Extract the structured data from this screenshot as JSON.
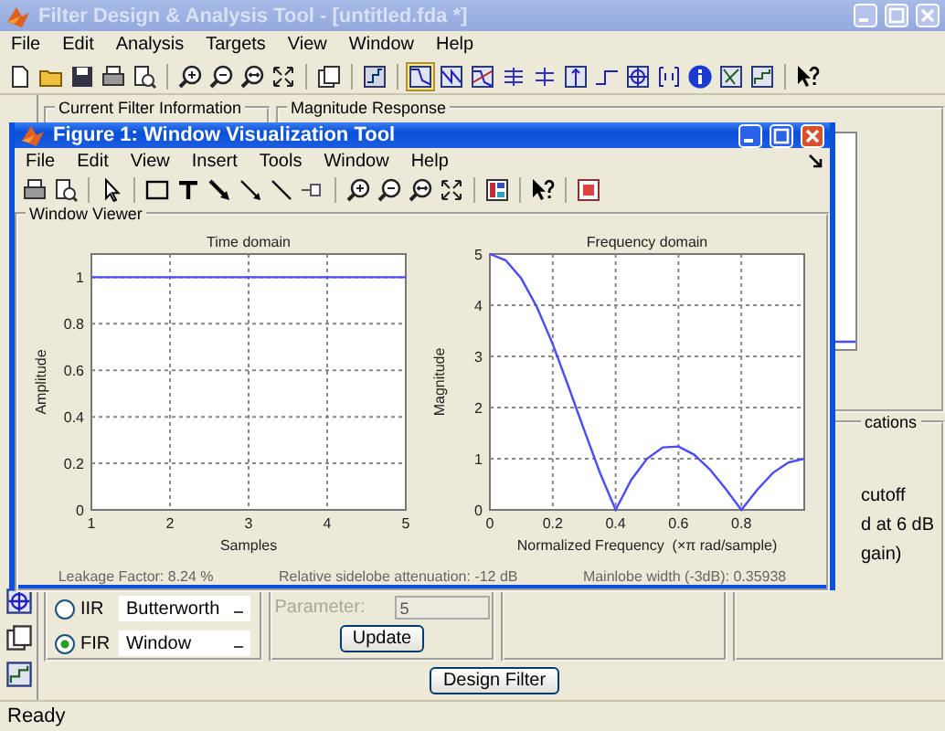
{
  "window": {
    "title": "Filter Design & Analysis Tool - [untitled.fda *]",
    "active": false
  },
  "menu": [
    "File",
    "Edit",
    "Analysis",
    "Targets",
    "View",
    "Window",
    "Help"
  ],
  "analysis_buttons": [
    {
      "kind": "magnitude",
      "selected": true
    },
    {
      "kind": "phase",
      "selected": false
    },
    {
      "kind": "magphase",
      "selected": false
    },
    {
      "kind": "groupdelay",
      "selected": false
    },
    {
      "kind": "phasedelay",
      "selected": false
    },
    {
      "kind": "impulse",
      "selected": false
    },
    {
      "kind": "step",
      "selected": false
    },
    {
      "kind": "polezero",
      "selected": false
    },
    {
      "kind": "coefficients",
      "selected": false
    },
    {
      "kind": "info",
      "selected": false
    },
    {
      "kind": "magest",
      "selected": false
    },
    {
      "kind": "noise",
      "selected": false
    }
  ],
  "current_filter_information": {
    "title": "Current Filter Information"
  },
  "magnitude_response": {
    "title": "Magnitude Response"
  },
  "response_panel": {
    "rows": [
      {
        "label": "IIR",
        "selected": false,
        "value": "Butterworth"
      },
      {
        "label": "FIR",
        "selected": true,
        "value": "Window"
      }
    ]
  },
  "options_panel": {
    "parameter": {
      "label": "Parameter:",
      "value": "5",
      "disabled": true
    },
    "update_button": "Update"
  },
  "specifications_panel": {
    "title": "cations",
    "lines": [
      "cutoff",
      "d at 6 dB",
      "gain)"
    ]
  },
  "design_button": "Design Filter",
  "status_bar": "Ready",
  "figure": {
    "title": "Figure 1: Window Visualization Tool",
    "active": true,
    "menu": [
      "File",
      "Edit",
      "View",
      "Insert",
      "Tools",
      "Window",
      "Help"
    ],
    "viewer": {
      "title": "Window Viewer",
      "charts": [
        {
          "chart_data": {
            "type": "line",
            "title": "Time domain",
            "xlabel": "Samples",
            "ylabel": "Amplitude",
            "x": [
              1,
              2,
              3,
              4,
              5
            ],
            "grid": true,
            "xlim": [
              1,
              5
            ],
            "ylim": [
              0,
              1.1
            ],
            "xticks": [
              1,
              2,
              3,
              4,
              5
            ],
            "yticks": [
              0,
              0.2,
              0.4,
              0.6,
              0.8,
              1
            ],
            "series": [
              {
                "color": "#4a4aff",
                "values": [
                  1,
                  1,
                  1,
                  1,
                  1
                ]
              }
            ]
          }
        },
        {
          "chart_data": {
            "type": "line",
            "title": "Frequency domain",
            "xlabel": "Normalized Frequency  (×π rad/sample)",
            "ylabel": "Magnitude",
            "x": [
              0,
              0.05,
              0.1,
              0.15,
              0.2,
              0.25,
              0.3,
              0.35,
              0.4,
              0.45,
              0.5,
              0.55,
              0.6,
              0.65,
              0.7,
              0.75,
              0.8,
              0.85,
              0.9,
              0.95,
              1
            ],
            "grid": true,
            "xlim": [
              0,
              1
            ],
            "ylim": [
              0,
              5
            ],
            "xticks": [
              0,
              0.2,
              0.4,
              0.6,
              0.8
            ],
            "yticks": [
              0,
              1,
              2,
              3,
              4,
              5
            ],
            "series": [
              {
                "color": "#4a4aff",
                "values": [
                  5,
                  4.88,
                  4.52,
                  3.96,
                  3.24,
                  2.41,
                  1.56,
                  0.73,
                  0,
                  0.59,
                  1,
                  1.22,
                  1.24,
                  1.08,
                  0.79,
                  0.41,
                  0,
                  0.39,
                  0.72,
                  0.93,
                  1
                ]
              }
            ]
          }
        }
      ],
      "footer": [
        "Leakage Factor: 8.24 %",
        "Relative sidelobe attenuation: -12 dB",
        "Mainlobe width (-3dB): 0.35938"
      ]
    }
  }
}
